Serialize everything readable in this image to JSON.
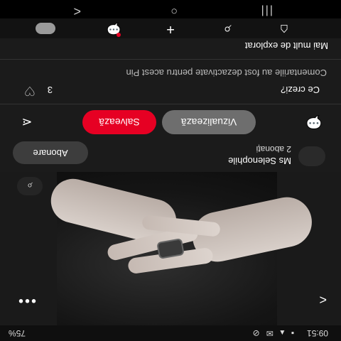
{
  "status_bar": {
    "time": "09:51",
    "battery": "75%",
    "signal_icons": "▪ ▴ ✉ ⊘"
  },
  "pin": {
    "image_alt": "",
    "back_icon": "<",
    "more_icon": "•••",
    "lens_icon": "⌕"
  },
  "creator": {
    "name": "Ms Selenophile",
    "followers": "2 abonați",
    "subscribe_label": "Abonare"
  },
  "actions": {
    "visit_label": "Vizualizează",
    "save_label": "Salvează",
    "comment_icon": "💬",
    "share_icon": "⋖"
  },
  "comments": {
    "heading": "Ce crezi?",
    "likes": "3",
    "disabled_text": "Comentariile au fost dezactivate pentru acest Pin"
  },
  "explore": {
    "heading": "Mai mult de explorat"
  },
  "bottom_nav": {
    "home_icon": "⌂",
    "search_icon": "⌕",
    "create_icon": "+",
    "messages_icon": "💬"
  },
  "system_nav": {
    "recent_icon": "|||",
    "home_icon": "○",
    "back_icon": "<"
  },
  "colors": {
    "save_red": "#e60023",
    "background": "#1b1b1b"
  }
}
